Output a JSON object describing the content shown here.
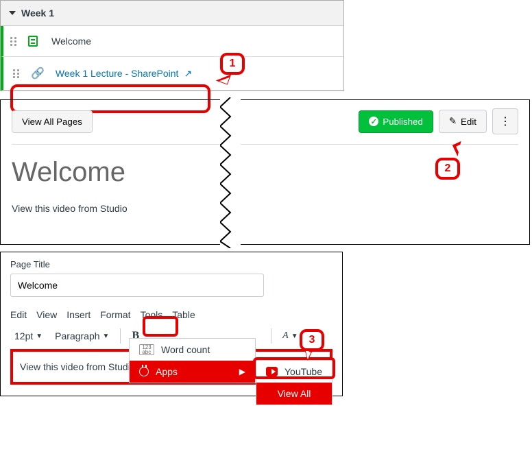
{
  "panel1": {
    "module_title": "Week 1",
    "item1": {
      "title": "Welcome"
    },
    "item2": {
      "title": "Week 1 Lecture - SharePoint"
    }
  },
  "panel2": {
    "view_all": "View All Pages",
    "published": "Published",
    "edit": "Edit",
    "heading": "Welcome",
    "body": "View this video from Studio"
  },
  "panel3": {
    "label": "Page Title",
    "title_value": "Welcome",
    "menubar": {
      "edit": "Edit",
      "view": "View",
      "insert": "Insert",
      "format": "Format",
      "tools": "Tools",
      "table": "Table"
    },
    "toolbar": {
      "font_size": "12pt",
      "block": "Paragraph",
      "bold": "B"
    },
    "tools_menu": {
      "word_count": "Word count",
      "apps": "Apps"
    },
    "apps_menu": {
      "youtube": "YouTube",
      "view_all": "View All"
    },
    "content": "View this video from Studio"
  },
  "callouts": {
    "c1": "1",
    "c2": "2",
    "c3": "3"
  }
}
